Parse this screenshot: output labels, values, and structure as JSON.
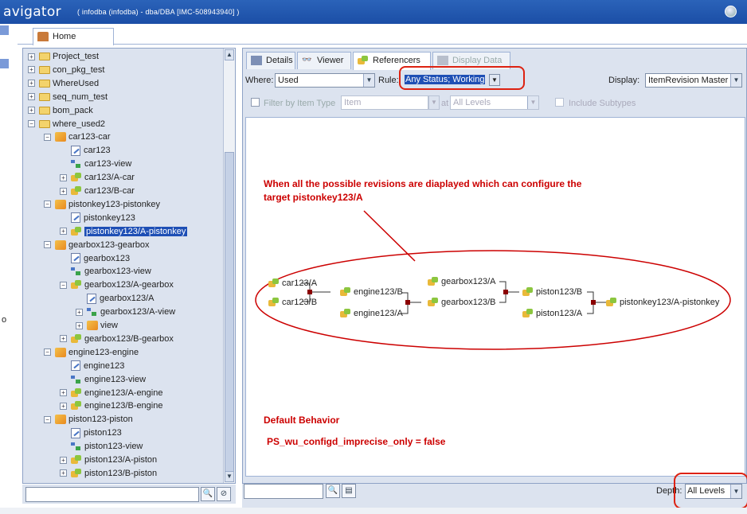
{
  "window": {
    "title": "avigator",
    "context": "( infodba (infodba) - dba/DBA   [IMC-508943940] )"
  },
  "left_edge": {
    "label": "o"
  },
  "home_tab": {
    "label": "Home"
  },
  "tree": {
    "items": [
      {
        "label": "Project_test",
        "icon": "folder-icon",
        "expander": "+"
      },
      {
        "label": "con_pkg_test",
        "icon": "folder-icon",
        "expander": "+"
      },
      {
        "label": "WhereUsed",
        "icon": "folder-icon",
        "expander": "+"
      },
      {
        "label": "seq_num_test",
        "icon": "folder-icon",
        "expander": "+"
      },
      {
        "label": "bom_pack",
        "icon": "folder-icon",
        "expander": "+"
      },
      {
        "label": "where_used2",
        "icon": "folder-icon",
        "expander": "−"
      },
      {
        "label": "car123-car",
        "icon": "item-icon",
        "expander": "−"
      },
      {
        "label": "car123",
        "icon": "master-form-icon",
        "expander": ""
      },
      {
        "label": "car123-view",
        "icon": "bom-view-icon",
        "expander": ""
      },
      {
        "label": "car123/A-car",
        "icon": "item-revision-icon",
        "expander": "+"
      },
      {
        "label": "car123/B-car",
        "icon": "item-revision-icon",
        "expander": "+"
      },
      {
        "label": "pistonkey123-pistonkey",
        "icon": "item-icon",
        "expander": "−"
      },
      {
        "label": "pistonkey123",
        "icon": "master-form-icon",
        "expander": ""
      },
      {
        "label": "pistonkey123/A-pistonkey",
        "icon": "item-revision-icon",
        "expander": "+",
        "selected": true
      },
      {
        "label": "gearbox123-gearbox",
        "icon": "item-icon",
        "expander": "−"
      },
      {
        "label": "gearbox123",
        "icon": "master-form-icon",
        "expander": ""
      },
      {
        "label": "gearbox123-view",
        "icon": "bom-view-icon",
        "expander": ""
      },
      {
        "label": "gearbox123/A-gearbox",
        "icon": "item-revision-icon",
        "expander": "−"
      },
      {
        "label": "gearbox123/A",
        "icon": "master-form-icon",
        "expander": ""
      },
      {
        "label": "gearbox123/A-view",
        "icon": "bom-view-icon",
        "expander": "+"
      },
      {
        "label": "view",
        "icon": "view-icon",
        "expander": "+"
      },
      {
        "label": "gearbox123/B-gearbox",
        "icon": "item-revision-icon",
        "expander": "+"
      },
      {
        "label": "engine123-engine",
        "icon": "item-icon",
        "expander": "−"
      },
      {
        "label": "engine123",
        "icon": "master-form-icon",
        "expander": ""
      },
      {
        "label": "engine123-view",
        "icon": "bom-view-icon",
        "expander": ""
      },
      {
        "label": "engine123/A-engine",
        "icon": "item-revision-icon",
        "expander": "+"
      },
      {
        "label": "engine123/B-engine",
        "icon": "item-revision-icon",
        "expander": "+"
      },
      {
        "label": "piston123-piston",
        "icon": "item-icon",
        "expander": "−"
      },
      {
        "label": "piston123",
        "icon": "master-form-icon",
        "expander": ""
      },
      {
        "label": "piston123-view",
        "icon": "bom-view-icon",
        "expander": ""
      },
      {
        "label": "piston123/A-piston",
        "icon": "item-revision-icon",
        "expander": "+"
      },
      {
        "label": "piston123/B-piston",
        "icon": "item-revision-icon",
        "expander": "+"
      }
    ]
  },
  "tabs": [
    {
      "label": "Details",
      "icon": "details-icon"
    },
    {
      "label": "Viewer",
      "icon": "viewer-icon"
    },
    {
      "label": "Referencers",
      "icon": "referencers-icon",
      "active": true
    },
    {
      "label": "Display Data",
      "icon": "display-data-icon",
      "disabled": true
    }
  ],
  "filters": {
    "where_label": "Where:",
    "where_value": "Used",
    "rule_label": "Rule:",
    "rule_value": "Any Status; Working",
    "display_label": "Display:",
    "display_value": "ItemRevision Master",
    "filter_type_label": "Filter by Item Type",
    "filter_type_value": "Item",
    "at_label": "at",
    "level_value": "All Levels",
    "include_subtypes_label": "Include Subtypes"
  },
  "graph": {
    "note_top_line1": "When all the possible revisions are diaplayed which can configure the",
    "note_top_line2": "target pistonkey123/A",
    "nodes": {
      "car_a": "car123/A",
      "car_b": "car123/B",
      "engine_b": "engine123/B",
      "engine_a": "engine123/A",
      "gearbox_a": "gearbox123/A",
      "gearbox_b": "gearbox123/B",
      "piston_b": "piston123/B",
      "piston_a": "piston123/A",
      "pistonkey_a": "pistonkey123/A-pistonkey"
    },
    "note_default": "Default Behavior",
    "note_pref": "PS_wu_configd_imprecise_only =   false"
  },
  "bottom": {
    "depth_label": "Depth:",
    "depth_value": "All Levels"
  },
  "colors": {
    "titlebar": "#1b4ea6",
    "annotation": "#cc0000",
    "selection": "#1e4fb5",
    "panel": "#dce3ef"
  }
}
